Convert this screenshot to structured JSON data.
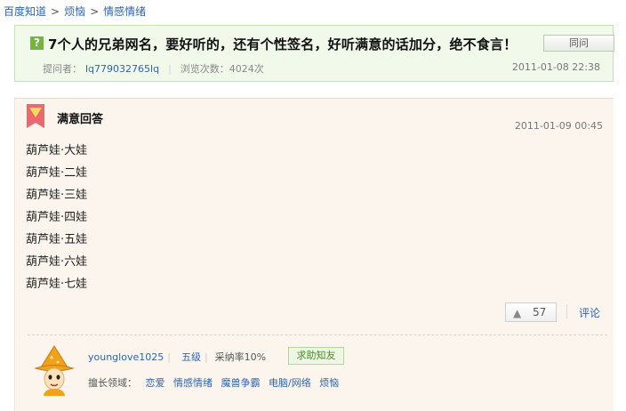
{
  "breadcrumb": {
    "home": "百度知道",
    "sep": ">",
    "level1": "烦恼",
    "level2": "情感情绪"
  },
  "question": {
    "icon_text": "?",
    "title": "7个人的兄弟网名，要好听的，还有个性签名，好听满意的话加分，绝不食言！",
    "button_label": "同问",
    "asker_label": "提问者：",
    "asker": "lq779032765lq",
    "views_label": "浏览次数：4024次",
    "date": "2011-01-08 22:38"
  },
  "answer": {
    "header": "满意回答",
    "date": "2011-01-09 00:45",
    "lines": [
      "葫芦娃·大娃",
      "葫芦娃·二娃",
      "葫芦娃·三娃",
      "葫芦娃·四娃",
      "葫芦娃·五娃",
      "葫芦娃·六娃",
      "葫芦娃·七娃"
    ],
    "likes": "57",
    "comment_label": "评论"
  },
  "answerer": {
    "username": "younglove1025",
    "level": "五级",
    "adoption_rate": "采纳率10%",
    "seek_button": "求助知友",
    "expertise_label": "擅长领域：",
    "expertise": [
      "恋爱",
      "情感情绪",
      "魔兽争霸",
      "电脑/网络",
      "烦恼"
    ]
  },
  "icons": {
    "ribbon": "best-answer-ribbon-icon",
    "thumb": "thumbs-up-icon",
    "avatar": "wizard-avatar"
  },
  "colors": {
    "link": "#2d64b3",
    "question_bg": "#f1f9eb",
    "answer_bg": "#fbf5ee",
    "question_icon": "#75b441",
    "ribbon": "#e86a6f"
  }
}
